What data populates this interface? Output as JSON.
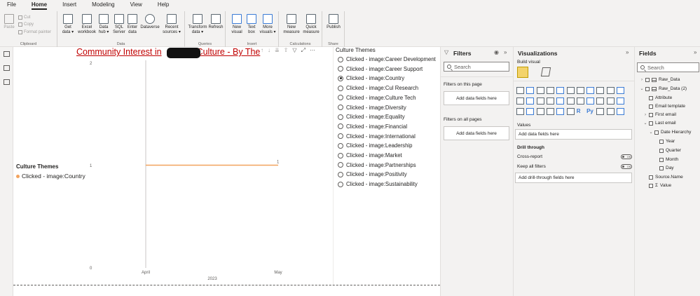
{
  "menu": [
    "File",
    "Home",
    "Insert",
    "Modeling",
    "View",
    "Help"
  ],
  "ribbon": {
    "clipboard": {
      "paste": "Paste",
      "cut": "Cut",
      "copy": "Copy",
      "format_painter": "Format painter",
      "label": "Clipboard"
    },
    "data": {
      "get_data": "Get data ▾",
      "excel": "Excel workbook",
      "data_hub": "Data hub ▾",
      "sql": "SQL Server",
      "enter_data": "Enter data",
      "dataverse": "Dataverse",
      "recent": "Recent sources ▾",
      "label": "Data"
    },
    "queries": {
      "transform": "Transform data ▾",
      "refresh": "Refresh",
      "label": "Queries"
    },
    "insert": {
      "new_visual": "New visual",
      "text_box": "Text box",
      "more_visuals": "More visuals ▾",
      "label": "Insert"
    },
    "calculations": {
      "new_measure": "New measure",
      "quick_measure": "Quick measure",
      "label": "Calculations"
    },
    "share": {
      "publish": "Publish",
      "label": "Share"
    }
  },
  "visual": {
    "title_prefix": "Community Interest in",
    "title_suffix": "Culture - By The",
    "legend_title": "Culture Themes",
    "legend_item": "Clicked - image:Country",
    "y_ticks": [
      "2",
      "1",
      "0"
    ],
    "x_ticks": [
      "April",
      "May"
    ],
    "x_axis_year": "2023",
    "data_label_value": "1",
    "line_color": "#f2a35e"
  },
  "chart_data": {
    "type": "line",
    "x": [
      "April",
      "May"
    ],
    "series": [
      {
        "name": "Clicked - image:Country",
        "values": [
          1,
          1
        ]
      }
    ],
    "ylim": [
      0,
      2
    ],
    "title": "Community Interest in ___ Culture - By The",
    "legend_title": "Culture Themes",
    "xlabel": "2023",
    "grid": false
  },
  "slicer": {
    "title": "Culture Themes",
    "selected_index": 2,
    "items": [
      "Clicked - image:Career Development",
      "Clicked - image:Career Support",
      "Clicked - image:Country",
      "Clicked - image:Cul Research",
      "Clicked - image:Culture Tech",
      "Clicked - image:Diversity",
      "Clicked - image:Equality",
      "Clicked - image:Financial",
      "Clicked - image:International",
      "Clicked - image:Leadership",
      "Clicked - image:Market",
      "Clicked - image:Partnerships",
      "Clicked - image:Positivity",
      "Clicked - image:Sustainability"
    ]
  },
  "filters": {
    "title": "Filters",
    "search_placeholder": "Search",
    "on_page": "Filters on this page",
    "on_all_pages": "Filters on all pages",
    "add_fields": "Add data fields here"
  },
  "visualizations": {
    "title": "Visualizations",
    "build_visual": "Build visual",
    "values_label": "Values",
    "values_drop": "Add data fields here",
    "drill_through": "Drill through",
    "cross_report": "Cross-report",
    "keep_all_filters": "Keep all filters",
    "toggle_off": "Off",
    "drill_drop": "Add drill-through fields here",
    "text_icons": [
      "R",
      "Py"
    ]
  },
  "fields": {
    "title": "Fields",
    "search_placeholder": "Search",
    "tables": [
      {
        "name": "Raw_Data",
        "expanded": false
      },
      {
        "name": "Raw_Data (2)",
        "expanded": true
      }
    ],
    "items": [
      "Attribute",
      "Email template",
      "First email",
      "Last email",
      "Date Hierarchy",
      "Year",
      "Quarter",
      "Month",
      "Day",
      "Source.Name",
      "Value"
    ]
  }
}
